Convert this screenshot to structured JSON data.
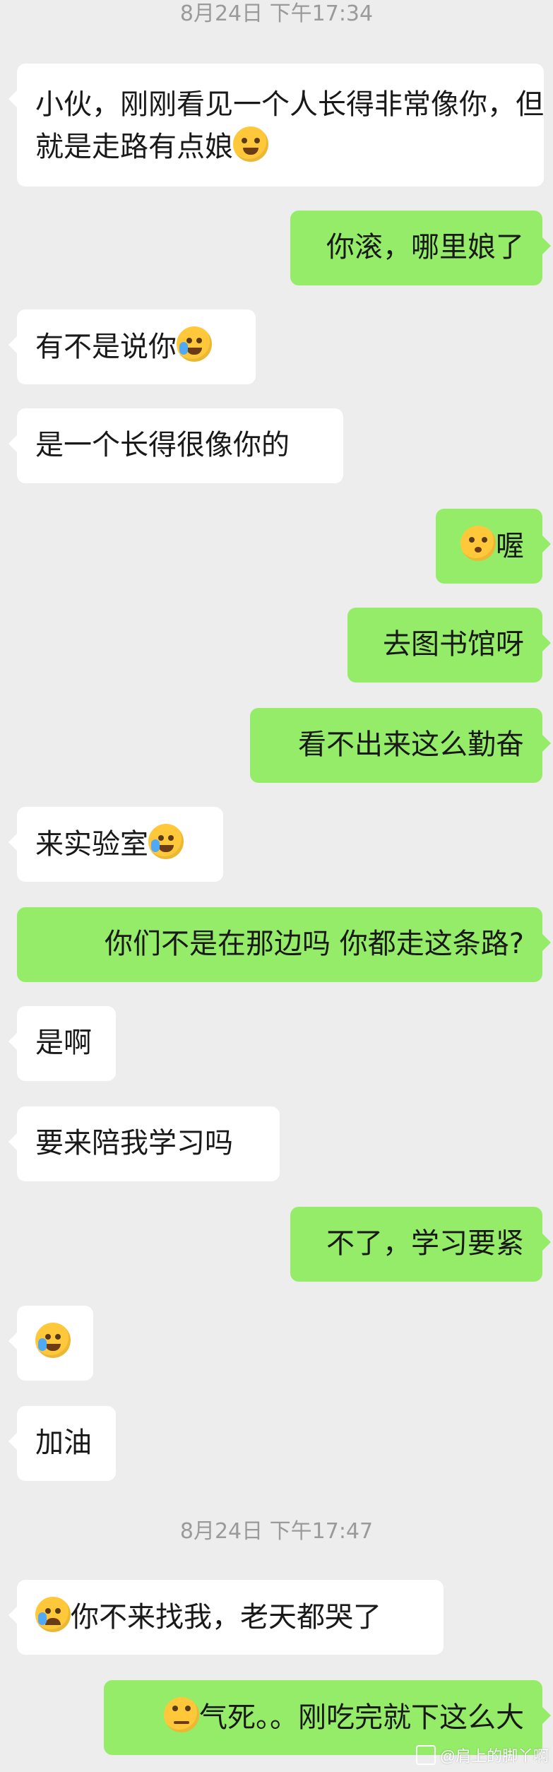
{
  "timestamps": [
    "8月24日 下午17:34",
    "8月24日 下午17:47"
  ],
  "messages": [
    {
      "side": "in",
      "text": "小伙，刚刚看见一个人长得非常像你，但就是走路有点娘",
      "emoji_after": "grin-icon"
    },
    {
      "side": "out",
      "text": "你滚，哪里娘了"
    },
    {
      "side": "in",
      "text": "有不是说你",
      "emoji_after": "facepalm-laugh-icon"
    },
    {
      "side": "in",
      "text": "是一个长得很像你的"
    },
    {
      "side": "out",
      "text": "喔",
      "emoji_before": "kiss-icon"
    },
    {
      "side": "out",
      "text": "去图书馆呀"
    },
    {
      "side": "out",
      "text": "看不出来这么勤奋"
    },
    {
      "side": "in",
      "text": "来实验室",
      "emoji_after": "facepalm-laugh-icon"
    },
    {
      "side": "out",
      "text": "你们不是在那边吗 你都走这条路?"
    },
    {
      "side": "in",
      "text": "是啊"
    },
    {
      "side": "in",
      "text": "要来陪我学习吗"
    },
    {
      "side": "out",
      "text": "不了，学习要紧"
    },
    {
      "side": "in",
      "text": "",
      "emoji_only": "facepalm-laugh-icon"
    },
    {
      "side": "in",
      "text": "加油"
    },
    {
      "side": "in",
      "text": "你不来找我，老天都哭了",
      "emoji_before": "crying-icon"
    },
    {
      "side": "out",
      "text": "气死。。刚吃完就下这么大",
      "emoji_before": "eye-roll-icon"
    }
  ],
  "watermark": "@肩上的脚丫啊",
  "colors": {
    "background": "#ededed",
    "incoming": "#ffffff",
    "outgoing": "#95ec69",
    "timestamp": "#9a9a9a"
  }
}
